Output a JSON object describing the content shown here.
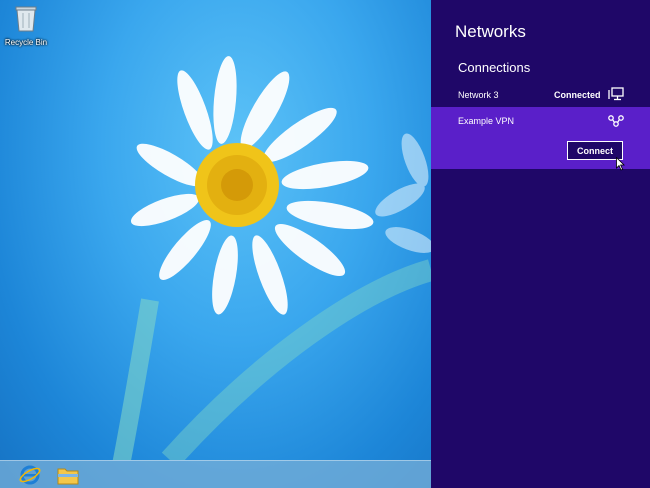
{
  "desktop": {
    "recycle_bin_label": "Recycle Bin",
    "taskbar": {
      "items": [
        {
          "icon": "internet-explorer-icon"
        },
        {
          "icon": "file-explorer-icon"
        }
      ]
    }
  },
  "charm": {
    "title": "Networks",
    "section": "Connections",
    "networks": [
      {
        "name": "Network  3",
        "status": "Connected",
        "icon": "wired-network-icon"
      }
    ],
    "vpn": {
      "name": "Example VPN",
      "icon": "vpn-icon",
      "button_label": "Connect"
    }
  },
  "colors": {
    "charm_bg": "#1f0768",
    "selected_bg": "#5a1fc9"
  }
}
